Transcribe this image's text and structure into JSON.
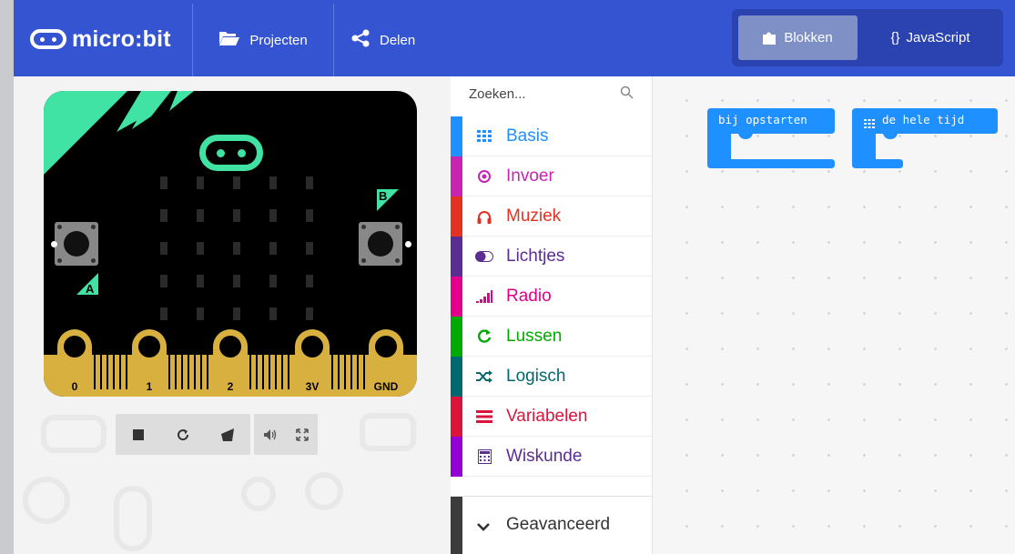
{
  "header": {
    "logo_text": "micro:bit",
    "nav_projects": "Projecten",
    "nav_share": "Delen",
    "mode_blocks": "Blokken",
    "mode_javascript": "JavaScript",
    "javascript_glyph": "{}"
  },
  "simulator": {
    "button_a": "A",
    "button_b": "B",
    "pins": [
      "0",
      "1",
      "2",
      "3V",
      "GND"
    ],
    "toolbar": [
      "stop-icon",
      "restart-icon",
      "debug-icon",
      "mute-icon",
      "fullscreen-icon"
    ]
  },
  "toolbox": {
    "search_placeholder": "Zoeken...",
    "categories": [
      {
        "label": "Basis",
        "icon": "grid-icon",
        "color": "#1e90ff"
      },
      {
        "label": "Invoer",
        "icon": "target-icon",
        "color": "#c724b1"
      },
      {
        "label": "Muziek",
        "icon": "headphones-icon",
        "color": "#e63022"
      },
      {
        "label": "Lichtjes",
        "icon": "toggle-icon",
        "color": "#5c2d91"
      },
      {
        "label": "Radio",
        "icon": "signal-icon",
        "color": "#e3008c"
      },
      {
        "label": "Lussen",
        "icon": "loop-icon",
        "color": "#00aa00"
      },
      {
        "label": "Logisch",
        "icon": "shuffle-icon",
        "color": "#006970"
      },
      {
        "label": "Variabelen",
        "icon": "list-icon",
        "color": "#dc143c"
      },
      {
        "label": "Wiskunde",
        "icon": "calculator-icon",
        "color": "#9400d3"
      }
    ],
    "advanced_label": "Geavanceerd"
  },
  "workspace": {
    "block_on_start": "bij opstarten",
    "block_forever": "de hele tijd",
    "block_color": "#1e90ff"
  },
  "colors": {
    "header": "#3454d1",
    "board_edge": "#d8b040",
    "logo_green": "#41e3a4"
  }
}
